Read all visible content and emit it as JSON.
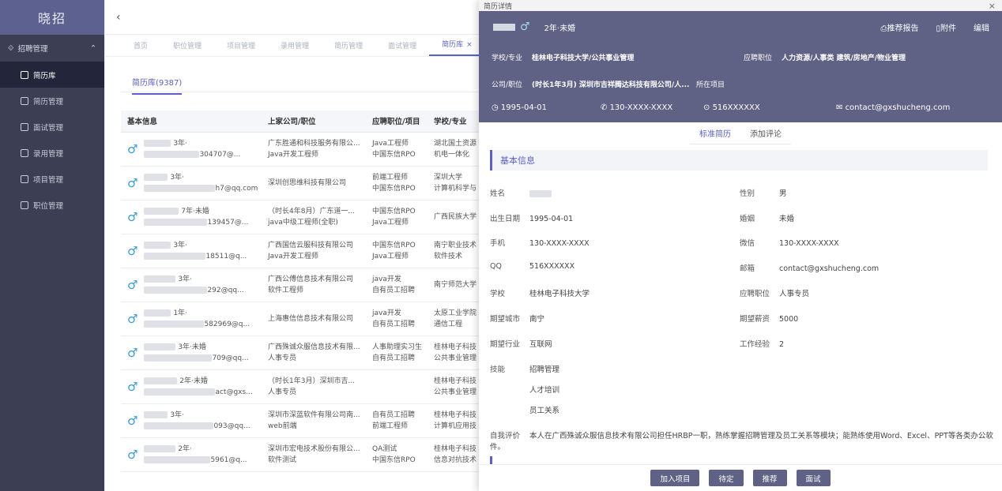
{
  "sidebar": {
    "logo": "晓招",
    "group": "招聘管理",
    "items": [
      {
        "label": "简历库",
        "active": true
      },
      {
        "label": "简历管理"
      },
      {
        "label": "面试管理"
      },
      {
        "label": "录用管理"
      },
      {
        "label": "项目管理"
      },
      {
        "label": "职位管理"
      }
    ]
  },
  "tabs": [
    "首页",
    "职位管理",
    "项目管理",
    "录用管理",
    "简历管理",
    "面试管理",
    "简历库"
  ],
  "library_tab": "简历库(9387)",
  "table": {
    "headers": [
      "基本信息",
      "上家公司/职位",
      "应聘职位/项目",
      "学校/专业"
    ],
    "rows": [
      {
        "info1": "3年·",
        "info2": "304707@...",
        "company": "广东胜通和科技服务有限公...",
        "position": "Java开发工程师",
        "job": "Java工程师",
        "project": "中国东信RPO",
        "school": "湖北国土资源",
        "major": "机电一体化"
      },
      {
        "info1": "3年·",
        "info2": "h7@qq.com",
        "company": "深圳创思维科技有限公司",
        "position": "",
        "job": "前端工程师",
        "project": "中国东信RPO",
        "school": "深圳大学",
        "major": "计算机科学与"
      },
      {
        "info1": "7年·未婚",
        "info2": "139457@...",
        "company": "（时长4年8月）广东道一...",
        "position": "java中级工程师(全职)",
        "job": "中国东信RPO",
        "project": "Java工程师",
        "school": "广西民族大学",
        "major": ""
      },
      {
        "info1": "3年·",
        "info2": "18511@q...",
        "company": "广西国信云服科技有限公司",
        "position": "Java开发工程师",
        "job": "中国东信RPO",
        "project": "Java工程师",
        "school": "南宁职业技术",
        "major": "软件技术"
      },
      {
        "info1": "3年·",
        "info2": "292@qq...",
        "company": "广西公傅信息技术有限公司",
        "position": "软件工程师",
        "job": "java开发",
        "project": "自有员工招聘",
        "school": "南宁师范大学",
        "major": ""
      },
      {
        "info1": "1年·",
        "info2": "582969@q...",
        "company": "上海惠信信息技术有限公司",
        "position": "",
        "job": "java开发",
        "project": "自有员工招聘",
        "school": "太原工业学院",
        "major": "通信工程"
      },
      {
        "info1": "3年·未婚",
        "info2": "709@qq...",
        "company": "广西殊诚众服信息技术有限...",
        "position": "人事专员",
        "job": "人事助理实习生",
        "project": "自有员工招聘",
        "school": "桂林电子科技",
        "major": "公共事业管理"
      },
      {
        "info1": "2年·未婚",
        "info2": "act@gxs...",
        "company": "（时长1年3月）深圳市吉...",
        "position": "人事专员",
        "job": "",
        "project": "",
        "school": "桂林电子科技",
        "major": "公共事业管理"
      },
      {
        "info1": "3年·",
        "info2": "093@qq...",
        "company": "深圳市深蓝软件有限公司南...",
        "position": "web前端",
        "job": "自有员工招聘",
        "project": "前端工程师",
        "school": "桂林电子科技",
        "major": "计算机应用技"
      },
      {
        "info1": "2年·",
        "info2": "5961@q...",
        "company": "深圳市宏电技术股份有限公...",
        "position": "软件测试",
        "job": "QA测试",
        "project": "中国东信RPO",
        "school": "桂林电子科技",
        "major": "信息对抗技术"
      }
    ]
  },
  "drawer": {
    "title": "简历详情",
    "summary": "2年·未婚",
    "actions": [
      "推荐报告",
      "附件",
      "编辑"
    ],
    "school_label": "学校/专业",
    "school_value": "桂林电子科技大学/公共事业管理",
    "apply_label": "应聘职位",
    "apply_value": "人力资源/人事类 建筑/房地产/物业管理",
    "company_label": "公司/职位",
    "company_value": "(时长1年3月) 深圳市吉祥腾达科技有限公司/人...",
    "project_label": "所在项目",
    "birth": "1995-04-01",
    "phone": "130-XXXX-XXXX",
    "qq": "516XXXXXX",
    "email": "contact@gxshucheng.com",
    "tabs": [
      "标准简历",
      "添加评论"
    ],
    "section": "基本信息",
    "fields": {
      "name_l": "姓名",
      "gender_l": "性别",
      "gender": "男",
      "birth_l": "出生日期",
      "marry_l": "婚姻",
      "marry": "未婚",
      "phone_l": "手机",
      "wechat_l": "微信",
      "qq_l": "QQ",
      "mail_l": "邮箱",
      "school_l": "学校",
      "school": "桂林电子科技大学",
      "job_l": "应聘职位",
      "job": "人事专员",
      "city_l": "期望城市",
      "city": "南宁",
      "salary_l": "期望薪资",
      "salary": "5000",
      "industry_l": "期望行业",
      "industry": "互联网",
      "exp_l": "工作经验",
      "exp": "2",
      "skill_l": "技能",
      "skills": [
        "招聘管理",
        "人才培训",
        "员工关系"
      ],
      "eval_l": "自我评价",
      "eval": "本人在广西殊诚众服信息技术有限公司担任HRBP一职，熟练掌握招聘管理及员工关系等模块；能熟练使用Word、Excel、PPT等各类办公软件。"
    },
    "buttons": [
      "加入项目",
      "待定",
      "推荐",
      "面试"
    ]
  }
}
